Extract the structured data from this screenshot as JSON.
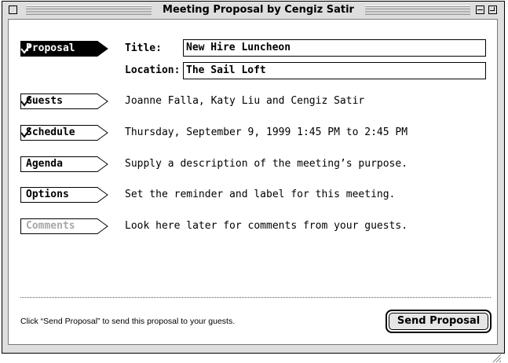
{
  "window": {
    "title": "Meeting Proposal by Cengiz Satir"
  },
  "nav": {
    "proposal": "Proposal",
    "guests": "Guests",
    "schedule": "Schedule",
    "agenda": "Agenda",
    "options": "Options",
    "comments": "Comments"
  },
  "proposal": {
    "title_label": "Title:",
    "title_value": "New Hire Luncheon",
    "location_label": "Location:",
    "location_value": "The Sail Loft"
  },
  "sections": {
    "guests_text": "Joanne Falla, Katy Liu and Cengiz Satir",
    "schedule_text": "Thursday, September 9, 1999  1:45 PM to  2:45 PM",
    "agenda_text": "Supply a description of the meeting’s purpose.",
    "options_text": "Set the reminder and label for this meeting.",
    "comments_text": "Look here later for comments from your guests."
  },
  "footer": {
    "hint": "Click “Send Proposal” to send this proposal to your guests.",
    "send_label": "Send Proposal"
  },
  "icons": {
    "close": "close-box-icon",
    "collapse": "collapse-box-icon",
    "zoom": "zoom-box-icon",
    "check": "checkmark-icon",
    "grow": "resize-grip-icon"
  },
  "colors": {
    "chrome": "#dedede",
    "selected_tab": "#000000",
    "disabled_text": "#a8a8a8"
  }
}
